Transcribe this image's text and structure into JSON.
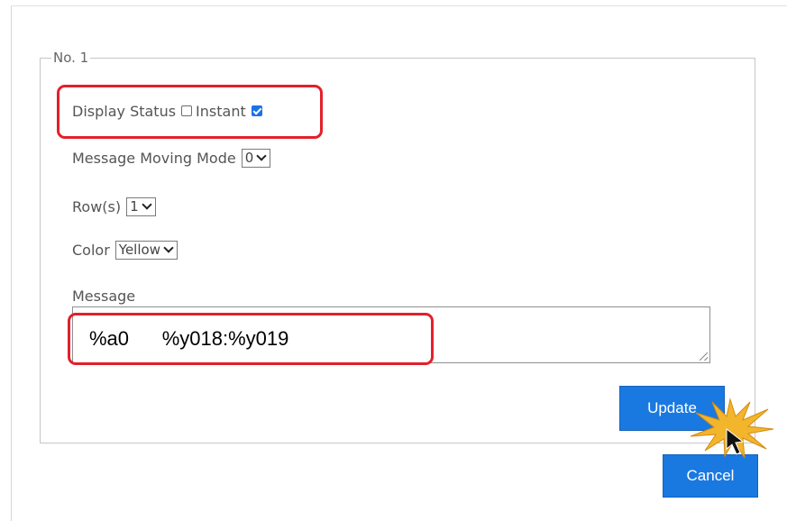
{
  "group": {
    "legend": "No. 1"
  },
  "display_status": {
    "label": "Display Status",
    "display_checked": false,
    "instant_label": "Instant",
    "instant_checked": true
  },
  "message_moving_mode": {
    "label": "Message Moving Mode",
    "value": "0"
  },
  "rows": {
    "label": "Row(s)",
    "value": "1"
  },
  "color": {
    "label": "Color",
    "value": "Yellow"
  },
  "message": {
    "label": "Message",
    "value": "%a0      %y018:%y019"
  },
  "buttons": {
    "update": "Update",
    "cancel": "Cancel"
  },
  "colors": {
    "highlight": "#e3202a",
    "button": "#1a79e0",
    "checkbox_checked": "#1a73e8"
  },
  "icons": {
    "cursor": "mouse-pointer-click-icon"
  }
}
